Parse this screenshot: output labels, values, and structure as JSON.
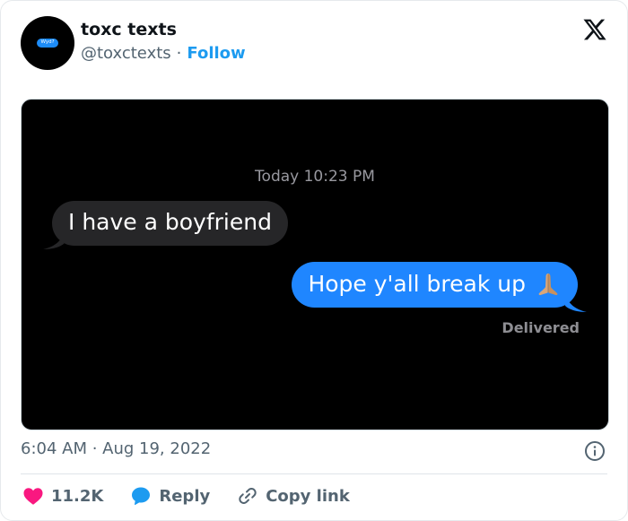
{
  "author": {
    "name": "toxc texts",
    "handle": "@toxctexts",
    "separator": "·",
    "follow_label": "Follow",
    "avatar_text": "Wyd?"
  },
  "brand_icon": "x-logo-icon",
  "conversation": {
    "timestamp": "Today 10:23 PM",
    "received_message": "I have a boyfriend",
    "sent_message": "Hope y'all break up",
    "sent_emoji": "folded-hands-emoji",
    "status": "Delivered"
  },
  "post": {
    "datetime": "6:04 AM · Aug 19, 2022"
  },
  "actions": {
    "like_count": "11.2K",
    "reply_label": "Reply",
    "copy_label": "Copy link"
  },
  "colors": {
    "follow": "#1d9bf0",
    "like": "#f91880",
    "reply": "#1d9bf0",
    "sent_bubble": "#1f86ff",
    "received_bubble": "#262628"
  }
}
